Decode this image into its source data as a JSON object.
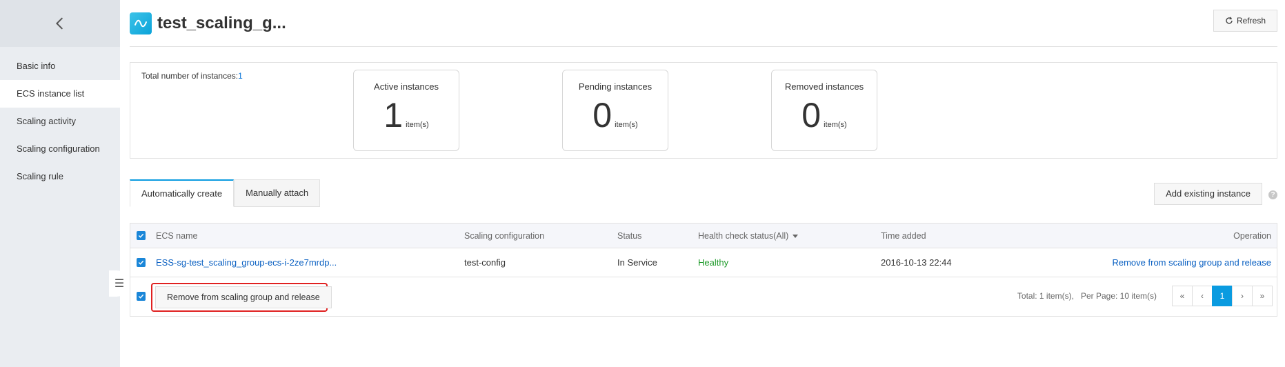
{
  "sidebar": {
    "items": [
      {
        "label": "Basic info"
      },
      {
        "label": "ECS instance list"
      },
      {
        "label": "Scaling activity"
      },
      {
        "label": "Scaling configuration"
      },
      {
        "label": "Scaling rule"
      }
    ]
  },
  "header": {
    "title": "test_scaling_g...",
    "refresh_label": "Refresh"
  },
  "summary": {
    "total_label": "Total number of instances:",
    "total_count": "1",
    "cards": [
      {
        "title": "Active instances",
        "value": "1",
        "unit": "item(s)"
      },
      {
        "title": "Pending instances",
        "value": "0",
        "unit": "item(s)"
      },
      {
        "title": "Removed instances",
        "value": "0",
        "unit": "item(s)"
      }
    ]
  },
  "tabs": [
    {
      "label": "Automatically create",
      "active": true
    },
    {
      "label": "Manually attach",
      "active": false
    }
  ],
  "add_existing_label": "Add existing instance",
  "table": {
    "columns": {
      "ecs_name": "ECS name",
      "scaling_config": "Scaling configuration",
      "status": "Status",
      "health": "Health check status(All)",
      "time_added": "Time added",
      "operation": "Operation"
    },
    "rows": [
      {
        "ecs_name": "ESS-sg-test_scaling_group-ecs-i-2ze7mrdp...",
        "scaling_config": "test-config",
        "status": "In Service",
        "health": "Healthy",
        "time_added": "2016-10-13 22:44",
        "operation": "Remove from scaling group and release"
      }
    ]
  },
  "footer": {
    "bulk_remove_label": "Remove from scaling group and release",
    "total_text": "Total: 1 item(s),",
    "per_page_text": "Per Page: 10 item(s)",
    "pages": {
      "first": "«",
      "prev": "‹",
      "current": "1",
      "next": "›",
      "last": "»"
    }
  },
  "colors": {
    "accent": "#0a9be0",
    "link": "#0a60c2",
    "healthy": "#1e9a2a",
    "highlight": "#e02020"
  }
}
